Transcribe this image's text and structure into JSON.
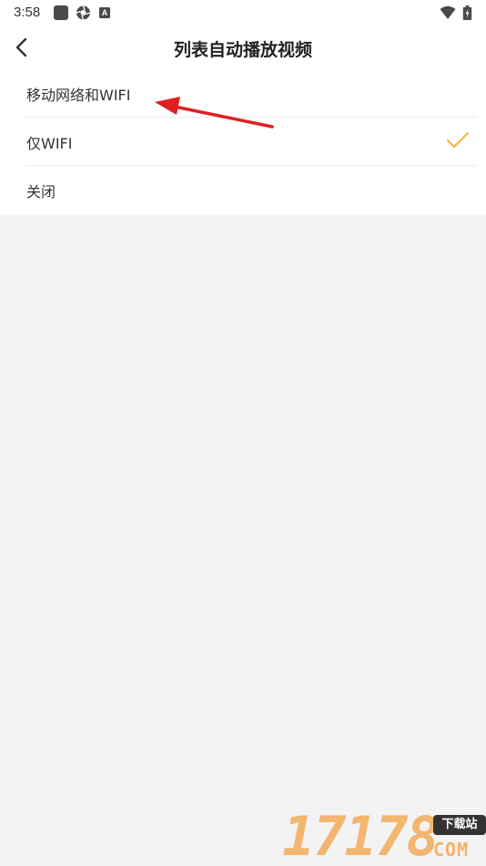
{
  "status_bar": {
    "time": "3:58",
    "icons": [
      "square-icon",
      "gear-icon",
      "a-icon",
      "wifi-icon",
      "battery-icon"
    ],
    "a_icon_letter": "A"
  },
  "header": {
    "title": "列表自动播放视频",
    "back_icon": "chevron-left-icon"
  },
  "options": [
    {
      "label": "移动网络和WIFI",
      "selected": false
    },
    {
      "label": "仅WIFI",
      "selected": true
    },
    {
      "label": "关闭",
      "selected": false
    }
  ],
  "colors": {
    "accent_check": "#f6b73c",
    "annotation_arrow": "#e02020",
    "background": "#f3f3f3"
  },
  "watermark": {
    "digits": "17178",
    "badge": "下载站",
    "suffix": "COM"
  }
}
